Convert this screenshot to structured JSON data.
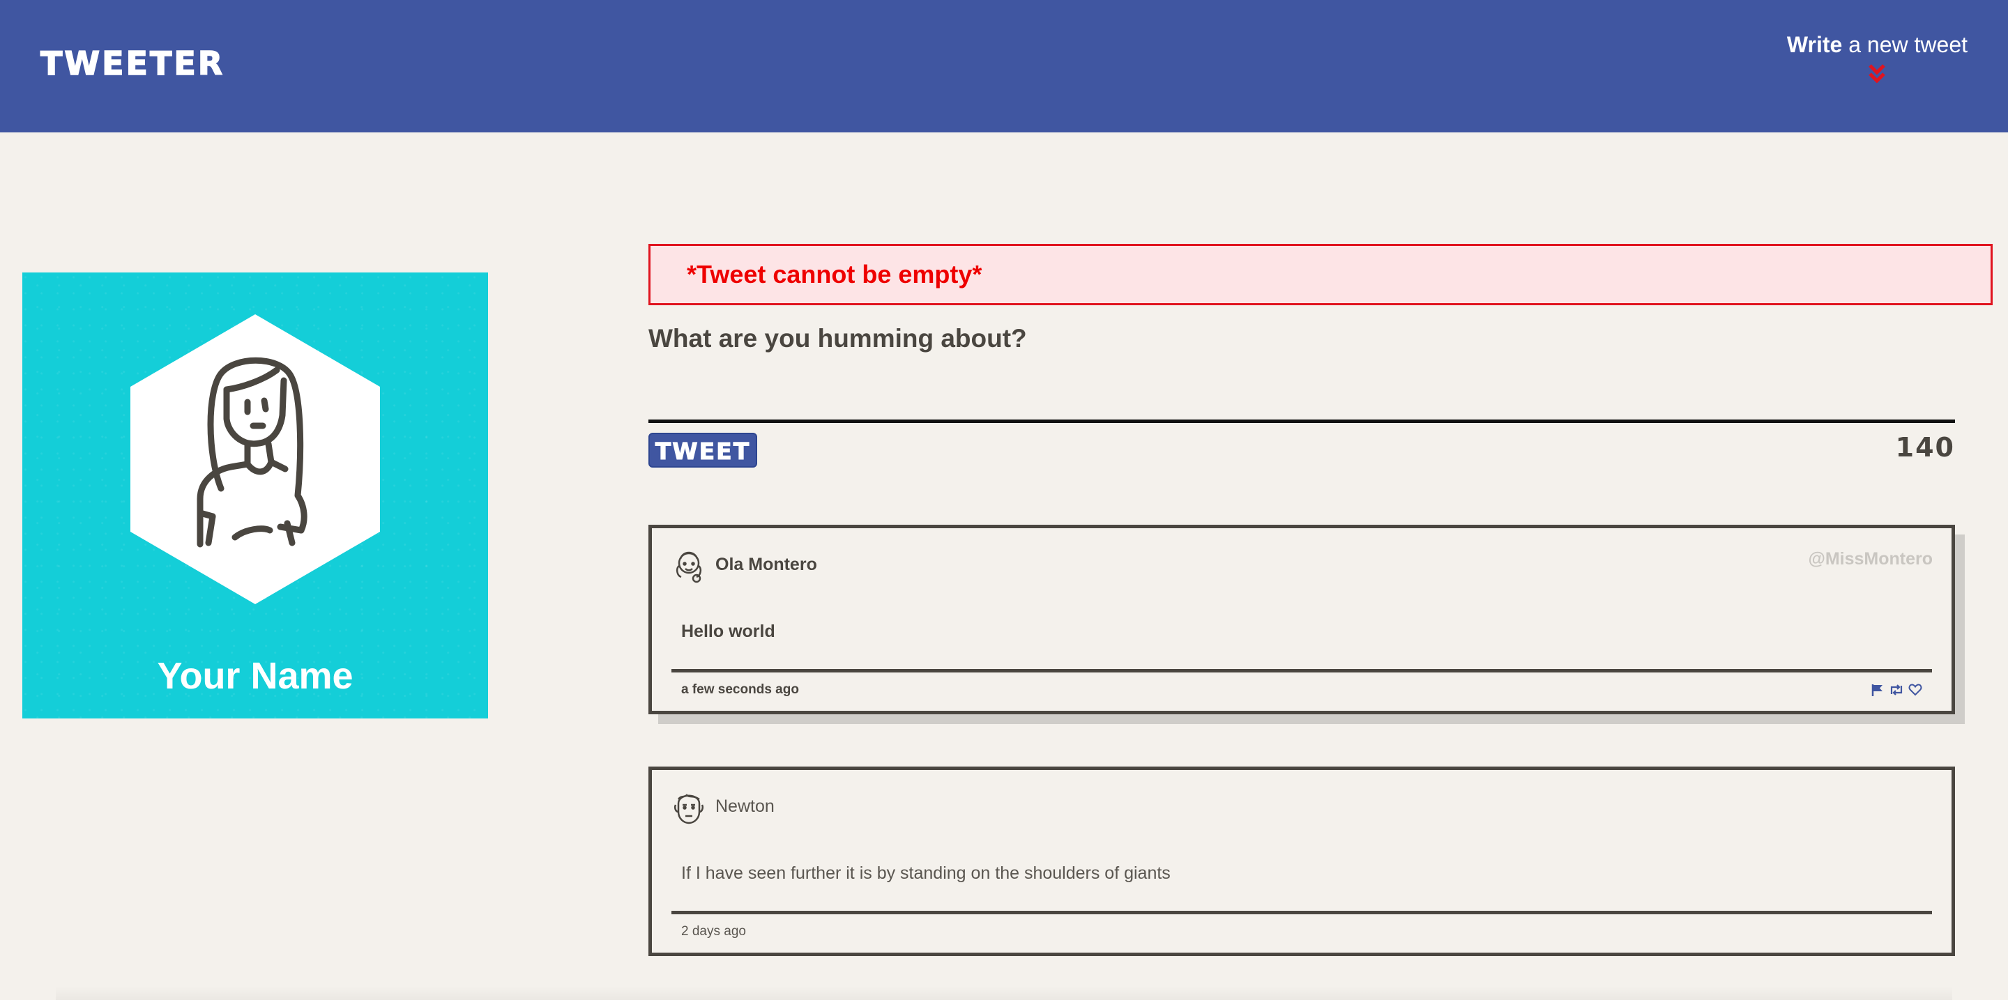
{
  "nav": {
    "logo": "TWEETER",
    "compose_bold": "Write",
    "compose_rest": " a new tweet"
  },
  "profile": {
    "name": "Your Name"
  },
  "compose": {
    "error": "*Tweet cannot be empty*",
    "prompt": "What are you humming about?",
    "button_label": "TWEET",
    "counter": "140"
  },
  "tweets": [
    {
      "name": "Ola Montero",
      "handle": "@MissMontero",
      "body": "Hello world",
      "time": "a few seconds ago"
    },
    {
      "name": "Newton",
      "handle": "",
      "body": "If I have seen further it is by standing on the shoulders of giants",
      "time": "2 days ago"
    }
  ],
  "colors": {
    "nav": "#4056a1",
    "background": "#f4f1ec",
    "profile": "#14ced8",
    "error_border": "#e0141f",
    "error_bg": "#fde4e6",
    "text": "#4a4640"
  }
}
